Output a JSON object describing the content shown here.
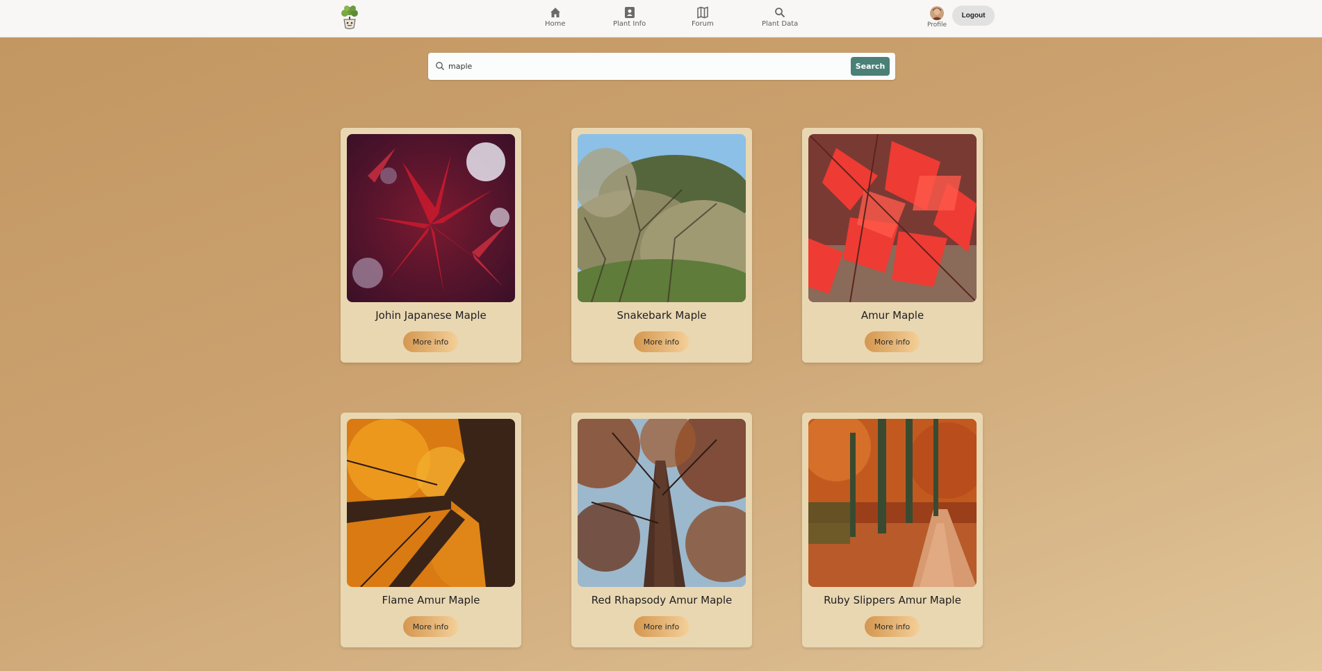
{
  "nav": {
    "items": [
      {
        "label": "Home",
        "icon": "home-icon"
      },
      {
        "label": "Plant Info",
        "icon": "plant-info-icon"
      },
      {
        "label": "Forum",
        "icon": "map-icon"
      },
      {
        "label": "Plant Data",
        "icon": "search-icon"
      }
    ],
    "profile_label": "Profile",
    "logout_label": "Logout"
  },
  "search": {
    "value": "maple",
    "button_label": "Search"
  },
  "cards": [
    {
      "name": "Johin Japanese Maple",
      "button": "More info"
    },
    {
      "name": "Snakebark Maple",
      "button": "More info"
    },
    {
      "name": "Amur Maple",
      "button": "More info"
    },
    {
      "name": "Flame Amur Maple",
      "button": "More info"
    },
    {
      "name": "Red Rhapsody Amur Maple",
      "button": "More info"
    },
    {
      "name": "Ruby Slippers Amur Maple",
      "button": "More info"
    }
  ],
  "colors": {
    "search_button": "#4a8077",
    "card_bg": "#e9d7b2",
    "header_bg": "#f8f7f5"
  }
}
